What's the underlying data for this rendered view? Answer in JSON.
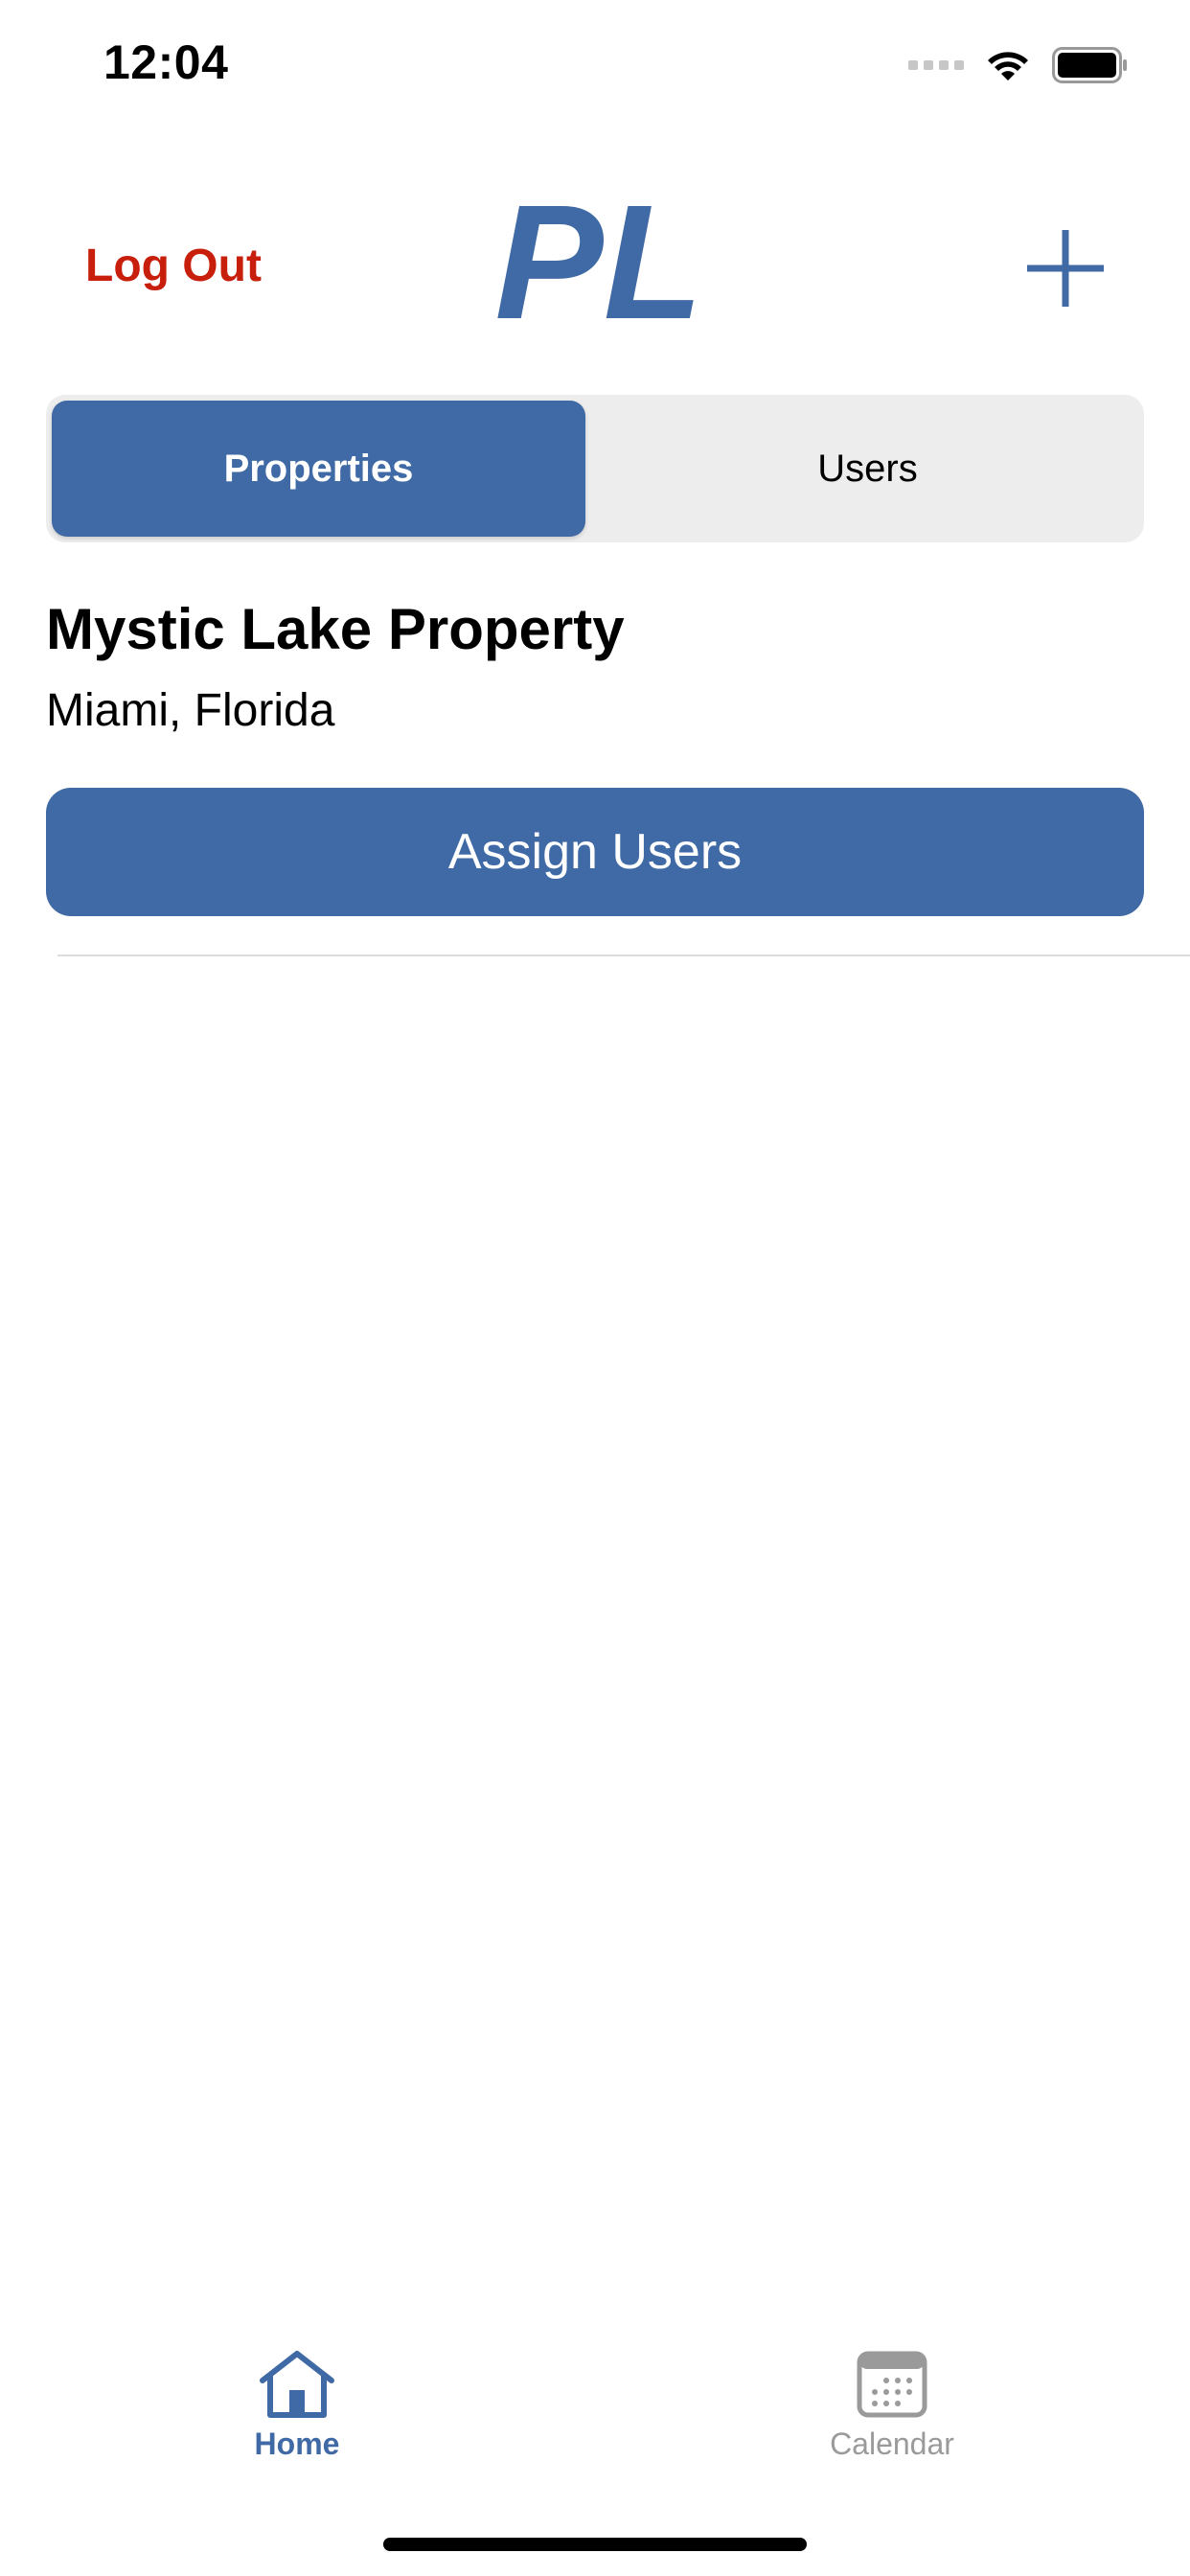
{
  "status_bar": {
    "time": "12:04"
  },
  "header": {
    "logout_label": "Log Out",
    "logo_text": "PL",
    "add_icon": "plus-icon"
  },
  "segmented": {
    "options": [
      "Properties",
      "Users"
    ],
    "selected": "Properties"
  },
  "property": {
    "name": "Mystic Lake Property",
    "location": "Miami, Florida",
    "assign_label": "Assign Users"
  },
  "tab_bar": {
    "items": [
      {
        "label": "Home",
        "icon": "home-icon",
        "active": true
      },
      {
        "label": "Calendar",
        "icon": "calendar-icon",
        "active": false
      }
    ]
  },
  "colors": {
    "accent": "#406aa5",
    "logout": "#c81e0c",
    "inactive_tab": "#9a9a9a",
    "segment_bg": "#ededed"
  }
}
